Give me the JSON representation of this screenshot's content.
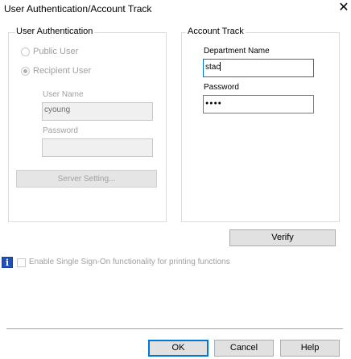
{
  "window": {
    "title": "User Authentication/Account Track",
    "close_glyph": "✕"
  },
  "user_auth": {
    "group_label": "User Authentication",
    "public_user_label": "Public User",
    "recipient_user_label": "Recipient User",
    "selected": "Recipient User",
    "user_name_label": "User Name",
    "user_name_value": "cyoung",
    "password_label": "Password",
    "password_value": "",
    "server_setting_label": "Server Setting..."
  },
  "account_track": {
    "group_label": "Account Track",
    "department_name_label": "Department Name",
    "department_name_value": "stac",
    "password_label": "Password",
    "password_value": "●●●●"
  },
  "verify_label": "Verify",
  "sso": {
    "info_glyph": "i",
    "label": "Enable Single Sign-On functionality for printing functions",
    "checked": false
  },
  "footer": {
    "ok_label": "OK",
    "cancel_label": "Cancel",
    "help_label": "Help"
  },
  "colors": {
    "focus": "#0078d7",
    "info_icon": "#1f4fb8"
  }
}
